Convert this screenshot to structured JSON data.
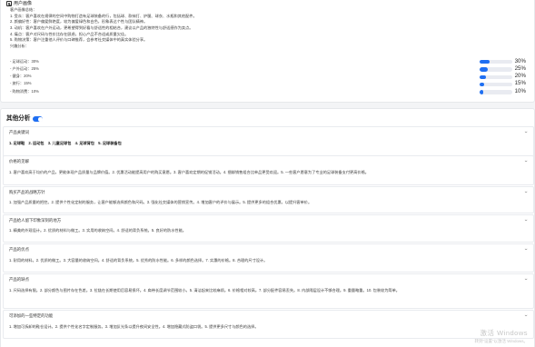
{
  "persona": {
    "title": "用户画像",
    "summary_lines": [
      "客户画像总结：",
      "1. 受众：客户喜欢在规律的空间中购物打造有足球装备的行，包括球、款袜打、护腿、球衣、水瓶和其他配件。",
      "2. 颜偏好性：客户偏爱鲜艳度，较为偏爱绿色和白色，形象表达个性与团队精神。",
      "3. 动机：客户喜欢在户外运动，更希望得到好看与舒适性的相结合，建议以产品的独特性与舒适感作为卖点。",
      "4. 痛点：客户对尺码与性价比存在顾虑，担心产品不合适或质量欠佳。",
      "5. 购物决策：客户注重他人评价与口碑推荐，会参考社交媒体中的真实体验分享。"
    ],
    "interests_title": "兴趣分析：",
    "interests": [
      {
        "label": "- 足球运动：30%",
        "percent_text": "30%",
        "value": 30
      },
      {
        "label": "- 户外运动：25%",
        "percent_text": "25%",
        "value": 25
      },
      {
        "label": "- 健身：20%",
        "percent_text": "20%",
        "value": 20
      },
      {
        "label": "- 旅行：15%",
        "percent_text": "15%",
        "value": 15
      },
      {
        "label": "- 购物消费：10%",
        "percent_text": "10%",
        "value": 10
      }
    ],
    "bar_color": "#1f6ff2"
  },
  "other": {
    "title": "其他分析",
    "toggle_on": true,
    "sections": [
      {
        "title": "产品关键词",
        "body": "1. 足球鞋　2. 运动包　3. 儿童足球包　4. 足球背包　5. 足球装备包",
        "bold": true,
        "chevron": "⌄"
      },
      {
        "title": "价格的见解",
        "body": "1. 客户喜欢高于均价的产品，更能体现产品质量与品牌价值。2. 优惠活动能提高用户的购买意愿。3. 客户喜欢定期的促销活动。4. 捆绑销售组合比单品更受欢迎。5. 一些客户愿意为了专业的足球装备支付更高价格。",
        "bold": false,
        "chevron": "⌄"
      },
      {
        "title": "购买产品的战略方针",
        "body": "1. 加强产品质量的把控。2. 提供个性化定制的服务，让客户能够选择颜色和尺码。3. 强化社交媒体的营销宣传。4. 增加客户的评价与展示。5. 提供更多的组合优惠，以提升客单价。",
        "bold": false,
        "chevron": "⌄"
      },
      {
        "title": "产品给人留下印象深刻的地方",
        "body": "1. 精美的外观设计。2. 优质的材料与做工。3. 实用的收纳空间。4. 舒适的背负系统。5. 良好的防水性能。",
        "bold": false,
        "chevron": "⌄"
      },
      {
        "title": "产品的优点",
        "body": "1. 耐用的材料。2. 优质的做工。3. 大容量的收纳空间。4. 舒适的背负系统。5. 优秀的防水性能。6. 多样的颜色选择。7. 实惠的价格。8. 合理的尺寸设计。",
        "bold": false,
        "chevron": "⌄"
      },
      {
        "title": "产品的缺点",
        "body": "1. 尺码选择有限。2. 部分颜色与图片存在色差。3. 拉链在长期使用后容易损坏。4. 肩带长度调节范围较小。5. 清洁起来比较麻烦。6. 价格相对较高。7. 部分配件容易丢失。8. 内部隔层设计不够合理。9. 重量略重。10. 包装较为简单。",
        "bold": false,
        "chevron": "⌄"
      },
      {
        "title": "可添加的一些特定的功能",
        "body": "1. 增加可拆卸的鞋仓设计。2. 提供个性化名字定制服务。3. 增加反光条以提升夜间安全性。4. 增加隐藏式防盗口袋。5. 提供更多尺寸与颜色的选择。",
        "bold": false,
        "chevron": "⌄"
      }
    ]
  },
  "watermark": {
    "line1": "激活 Windows",
    "line2": "转到“设置”以激活 Windows。"
  }
}
